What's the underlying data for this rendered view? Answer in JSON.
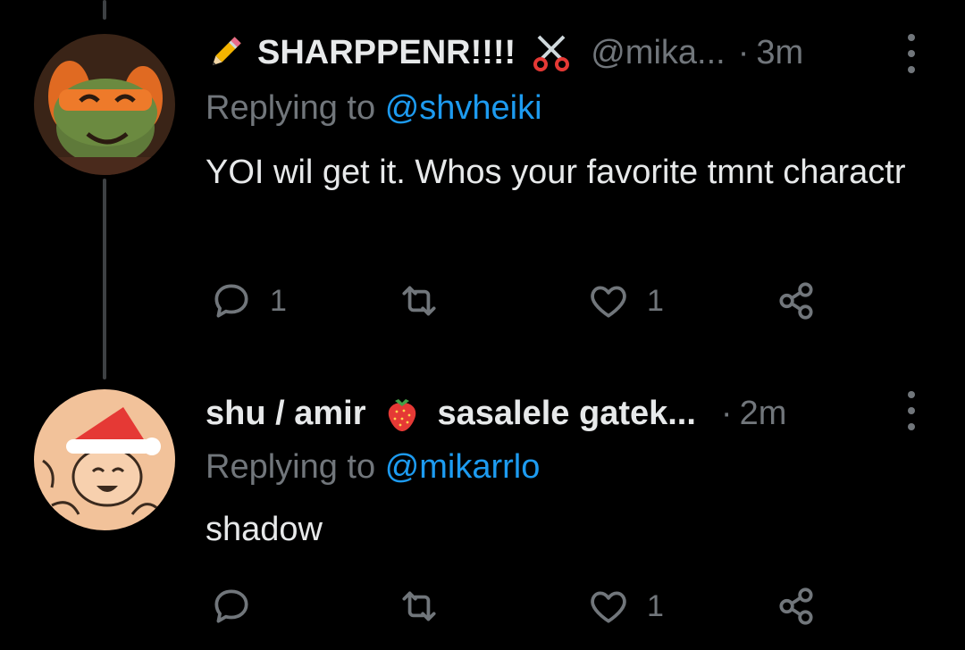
{
  "tweets": [
    {
      "name": "SHARPPENR!!!!",
      "handle": "@mika...",
      "dot": "·",
      "time": "3m",
      "reply_prefix": "Replying to",
      "reply_to": "@shvheiki",
      "text": "YOI wil get it. Whos your favorite tmnt charactr",
      "leading_emoji": "pencil-icon",
      "trailing_emoji": "scissors-icon",
      "actions": {
        "reply_count": "1",
        "retweet_count": "",
        "like_count": "1"
      }
    },
    {
      "name": "shu / amir",
      "name_suffix": "sasalele gatek...",
      "handle": "",
      "dot": "·",
      "time": "2m",
      "reply_prefix": "Replying to",
      "reply_to": "@mikarrlo",
      "text": "shadow",
      "trailing_emoji": "strawberry-icon",
      "actions": {
        "reply_count": "",
        "retweet_count": "",
        "like_count": "1"
      }
    }
  ],
  "colors": {
    "background": "#000000",
    "text": "#e7e9ea",
    "muted": "#71767b",
    "mention": "#1d9bf0",
    "thread_line": "#3e4144"
  }
}
